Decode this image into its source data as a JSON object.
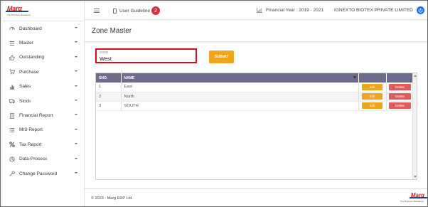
{
  "logo": {
    "text": "Marg",
    "tagline": "The Business Residence"
  },
  "sidebar": {
    "items": [
      {
        "label": "Dashboard",
        "icon": "dashboard-icon"
      },
      {
        "label": "Master",
        "icon": "list-icon"
      },
      {
        "label": "Outstanding",
        "icon": "thumbs-up-icon"
      },
      {
        "label": "Purchase",
        "icon": "cart-icon"
      },
      {
        "label": "Sales",
        "icon": "bar-chart-icon"
      },
      {
        "label": "Stock",
        "icon": "truck-icon"
      },
      {
        "label": "Financial Report",
        "icon": "document-icon"
      },
      {
        "label": "MIS Report",
        "icon": "list-icon"
      },
      {
        "label": "Tax Report",
        "icon": "percent-icon"
      },
      {
        "label": "Data-Process",
        "icon": "database-icon"
      },
      {
        "label": "Change Password",
        "icon": "key-icon"
      }
    ]
  },
  "topbar": {
    "user_guideline": "User Guideline",
    "badge_count": "2",
    "financial_year": "Financial Year : 2019 - 2021",
    "company": "IGNEXTO BIOTEX PRIVATE LIMITED"
  },
  "page": {
    "title": "Zone Master"
  },
  "form": {
    "zone_label": "ZONE",
    "zone_value": "West",
    "submit_label": "SUBMIT"
  },
  "table": {
    "headers": [
      "SNO.",
      "NAME",
      "",
      ""
    ],
    "rows": [
      {
        "sno": "1",
        "name": "East",
        "edit": "Edit",
        "delete": "Delete"
      },
      {
        "sno": "2",
        "name": "North",
        "edit": "Edit",
        "delete": "Delete"
      },
      {
        "sno": "3",
        "name": "SOUTH",
        "edit": "Edit",
        "delete": "Delete"
      }
    ]
  },
  "footer": {
    "copyright": "© 2023 - Marg ERP Ltd.",
    "logo_text": "Marg",
    "tagline": "The Business Residence"
  },
  "colors": {
    "accent": "#f0a51d",
    "header": "#6e6c8c",
    "delete": "#e15b5b",
    "highlight": "#d0111b",
    "badge": "#d9323f"
  }
}
